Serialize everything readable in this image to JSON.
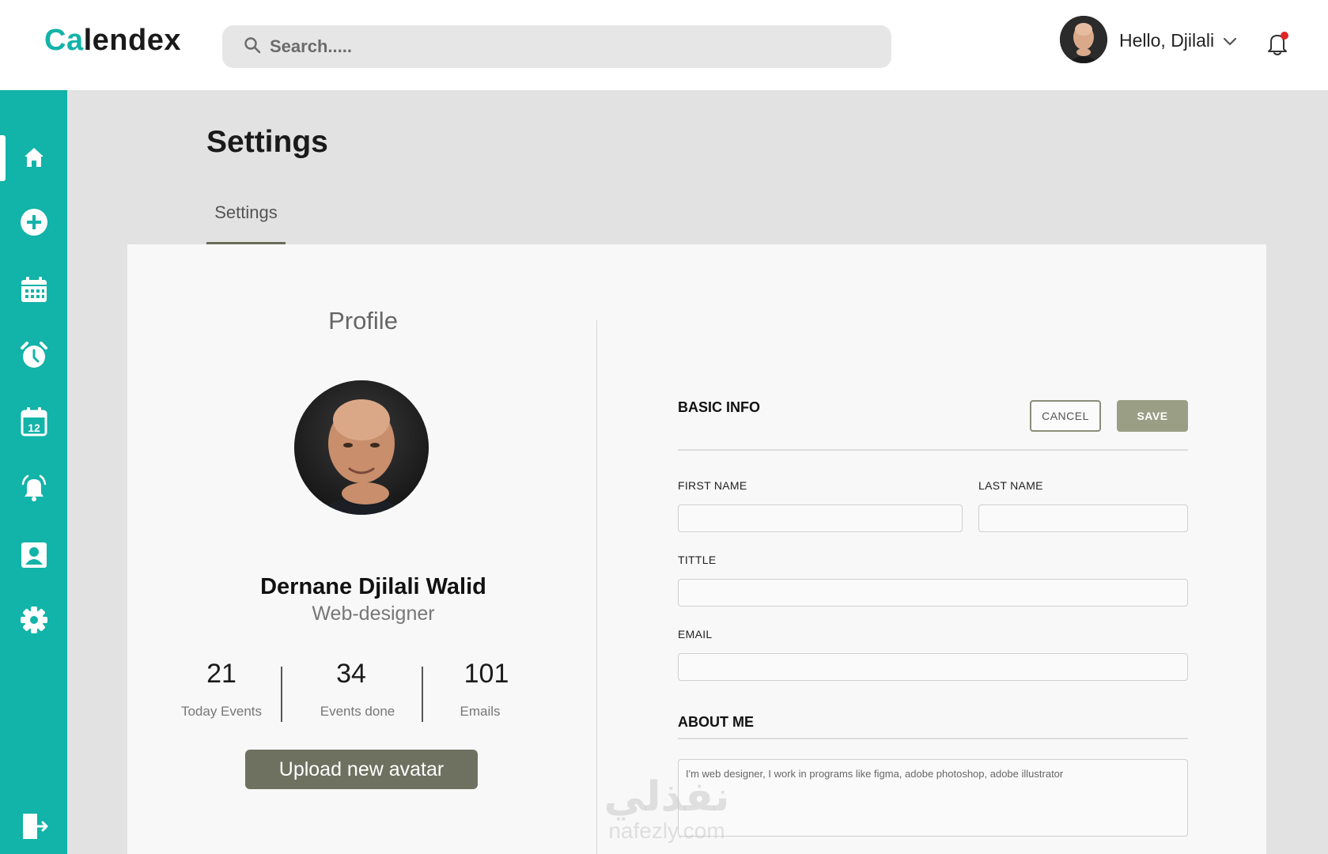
{
  "app": {
    "logo_prefix": "Ca",
    "logo_rest": "lendex"
  },
  "search": {
    "placeholder": "Search....."
  },
  "user": {
    "greeting": "Hello, Djilali"
  },
  "sidebar": {
    "items": [
      {
        "name": "home",
        "active": true
      },
      {
        "name": "add-event"
      },
      {
        "name": "calendar"
      },
      {
        "name": "alarm"
      },
      {
        "name": "calendar-day"
      },
      {
        "name": "notifications"
      },
      {
        "name": "contacts"
      },
      {
        "name": "settings"
      },
      {
        "name": "logout"
      }
    ]
  },
  "page": {
    "title": "Settings",
    "tabs": [
      {
        "label": "Settings",
        "active": true
      }
    ]
  },
  "profile": {
    "section_title": "Profile",
    "name": "Dernane Djilali Walid",
    "role": "Web-designer",
    "stats": [
      {
        "value": "21",
        "label": "Today Events"
      },
      {
        "value": "34",
        "label": "Events done"
      },
      {
        "value": "101",
        "label": "Emails"
      }
    ],
    "upload_label": "Upload new avatar"
  },
  "form": {
    "basic_info_title": "BASIC INFO",
    "cancel_label": "CANCEL",
    "save_label": "SAVE",
    "first_name_label": "FIRST NAME",
    "last_name_label": "LAST NAME",
    "title_label": "TITTLE",
    "email_label": "EMAIL",
    "first_name": "",
    "last_name": "",
    "title": "",
    "email": "",
    "about_title": "ABOUT ME",
    "about_text": "I'm web designer, I work in programs like figma, adobe photoshop, adobe illustrator"
  },
  "watermark": {
    "arabic": "نفذلي",
    "latin": "nafezly.com"
  },
  "colors": {
    "brand": "#12b3a8",
    "button_dark": "#6e7160",
    "button_save": "#9a9e85",
    "notification_dot": "#e02424"
  }
}
